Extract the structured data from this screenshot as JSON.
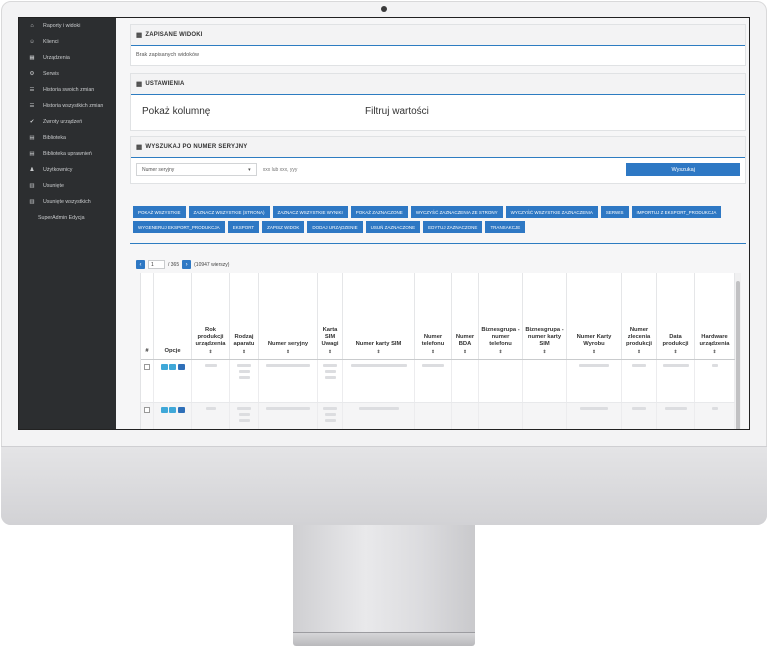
{
  "sidebar": {
    "items": [
      {
        "label": "Raporty i widoki",
        "icon": "home-icon",
        "glyph": "⌂"
      },
      {
        "label": "Klienci",
        "icon": "users-icon",
        "glyph": "☺"
      },
      {
        "label": "Urządzenia",
        "icon": "grid-icon",
        "glyph": "▦"
      },
      {
        "label": "Serwis",
        "icon": "gear-icon",
        "glyph": "⚙"
      },
      {
        "label": "Historia swoich zmian",
        "icon": "list-icon",
        "glyph": "☰"
      },
      {
        "label": "Historia wszystkich zmian",
        "icon": "list-icon",
        "glyph": "☰"
      },
      {
        "label": "Zwroty urządzeń",
        "icon": "check-icon",
        "glyph": "✔"
      },
      {
        "label": "Biblioteka",
        "icon": "book-icon",
        "glyph": "▤"
      },
      {
        "label": "Biblioteka uprawnień",
        "icon": "book-icon",
        "glyph": "▤"
      },
      {
        "label": "Użytkownicy",
        "icon": "user-icon",
        "glyph": "♟"
      },
      {
        "label": "Usunięte",
        "icon": "trash-icon",
        "glyph": "▥"
      },
      {
        "label": "Usunięte wszystkich",
        "icon": "trash-icon",
        "glyph": "▥"
      }
    ],
    "admin_label": "SuperAdmin Edycja"
  },
  "saved_views": {
    "title": "ZAPISANE WIDOKI",
    "empty_text": "Brak zapisanych widoków"
  },
  "settings": {
    "title": "USTAWIENIA",
    "show_columns": "Pokaż kolumnę",
    "filter_values": "Filtruj wartości"
  },
  "serial_search": {
    "title": "WYSZUKAJ PO NUMER SERYJNY",
    "select_value": "Numer seryjny",
    "input_placeholder": "xxx lub xxx, yyy",
    "button_label": "Wyszukaj"
  },
  "actions": {
    "row1": [
      "POKAŻ WSZYSTKIE",
      "ZAZNACZ WSZYSTKIE (STRONA)",
      "ZAZNACZ WSZYSTKIE WYNIKI",
      "POKAŻ ZAZNACZONE",
      "WYCZYŚĆ ZAZNACZENIA ZE STRONY",
      "WYCZYŚĆ WSZYSTKIE ZAZNACZENIA",
      "SERWIS",
      "IMPORTUJ Z EKSPORT_PRODUKCJA"
    ],
    "row2": [
      "WYGENERUJ EKSPORT_PRODUKCJA",
      "EKSPORT",
      "ZAPISZ WIDOK",
      "DODAJ URZĄDZENIE",
      "USUŃ ZAZNACZONE",
      "EDYTUJ ZAZNACZONE",
      "TRANSAKCJE"
    ]
  },
  "pager": {
    "prev": "‹",
    "next": "›",
    "page": "1",
    "of_total": "/ 365",
    "rows_info": "(10947 wierszy)"
  },
  "table": {
    "columns": [
      {
        "label": "#",
        "sortable": false
      },
      {
        "label": "Opcje",
        "sortable": false
      },
      {
        "label": "Rok produkcji urządzenia",
        "sortable": true
      },
      {
        "label": "Rodzaj aparatu",
        "sortable": true
      },
      {
        "label": "Numer seryjny",
        "sortable": true
      },
      {
        "label": "Karta SIM Uwagi",
        "sortable": true
      },
      {
        "label": "Numer karty SIM",
        "sortable": true
      },
      {
        "label": "Numer telefonu",
        "sortable": true
      },
      {
        "label": "Numer BDA",
        "sortable": true
      },
      {
        "label": "Biznesgrupa - numer telefonu",
        "sortable": true
      },
      {
        "label": "Biznesgrupa - numer karty SIM",
        "sortable": true
      },
      {
        "label": "Numer Karty Wyrobu",
        "sortable": true
      },
      {
        "label": "Numer zlecenia produkcji",
        "sortable": true
      },
      {
        "label": "Data produkcji",
        "sortable": true
      },
      {
        "label": "Hardware urządzenia",
        "sortable": true
      }
    ],
    "sort_glyph": "⇕"
  }
}
